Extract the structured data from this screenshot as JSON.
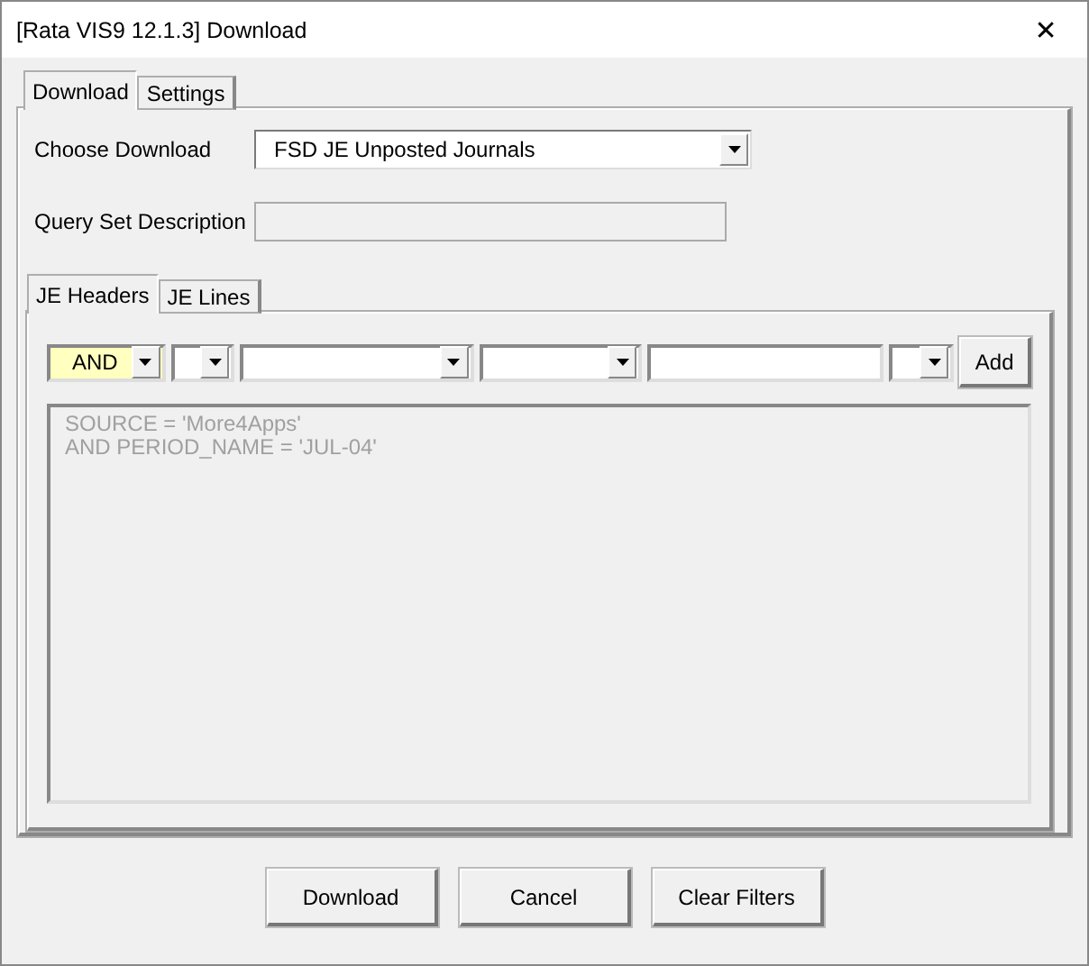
{
  "window": {
    "title": "[Rata VIS9 12.1.3] Download",
    "close": "✕"
  },
  "tabs": [
    {
      "label": "Download",
      "selected": true
    },
    {
      "label": "Settings",
      "selected": false
    }
  ],
  "choose_download": {
    "label": "Choose Download",
    "value": "FSD JE Unposted Journals"
  },
  "query_set_description": {
    "label": "Query Set Description"
  },
  "query_tabs": [
    {
      "label": "JE Headers",
      "selected": true
    },
    {
      "label": "JE Lines",
      "selected": false
    }
  ],
  "filter_row": [
    {
      "kind": "combo",
      "value": "AND",
      "focused": true
    },
    {
      "kind": "combo",
      "focused": false
    },
    {
      "kind": "combo",
      "focused": false
    },
    {
      "kind": "combo",
      "focused": false
    },
    {
      "kind": "text",
      "focused": false
    },
    {
      "kind": "combo",
      "focused": false
    }
  ],
  "add_button": "Add",
  "filter_text": [
    "SOURCE = 'More4Apps'",
    "AND PERIOD_NAME = 'JUL-04'"
  ],
  "buttons": [
    "Download",
    "Cancel",
    "Clear Filters"
  ]
}
